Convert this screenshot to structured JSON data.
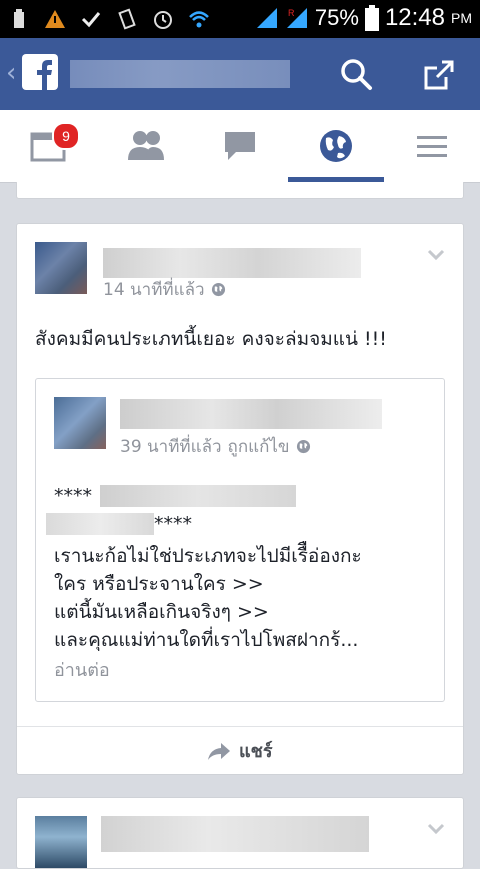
{
  "status_bar": {
    "battery_percent": "75%",
    "time": "12:48",
    "ampm": "PM",
    "icons": [
      "usb-icon",
      "warning-icon",
      "check-icon",
      "vibrate-icon",
      "alarm-icon",
      "wifi-icon",
      "signal-icon",
      "roaming-signal-icon",
      "battery-icon"
    ]
  },
  "app_bar": {
    "back_glyph": "‹",
    "logo_letter": "f",
    "colors": {
      "brand": "#3b5998",
      "notification": "#e02424"
    }
  },
  "tabs": {
    "news_feed_badge": "9",
    "items": [
      "news-feed",
      "friend-requests",
      "messages",
      "notifications",
      "more"
    ],
    "active": "notifications"
  },
  "post": {
    "time": "14 นาทีที่แล้ว",
    "text": "สังคมมีคนประเภทนี้เยอะ คงจะล่มจมแน่ !!!",
    "shared": {
      "time": "39 นาทีที่แล้ว",
      "edited": "ถูกแก้ไข",
      "line1_prefix": "****",
      "line2_suffix": "****",
      "line3": "เรานะก้อไม่ใช่ประเภทจะไปมีเรืือ่องกะ",
      "line4": "ใคร หรือประจานใคร >>",
      "line5": "แต่นี้มันเหลือเกินจริงๆ >>",
      "line6": "และคุณแม่ท่านใดที่เราไปโพสฝากร้...",
      "read_more": "อ่านต่อ"
    },
    "share_label": "แชร์"
  }
}
